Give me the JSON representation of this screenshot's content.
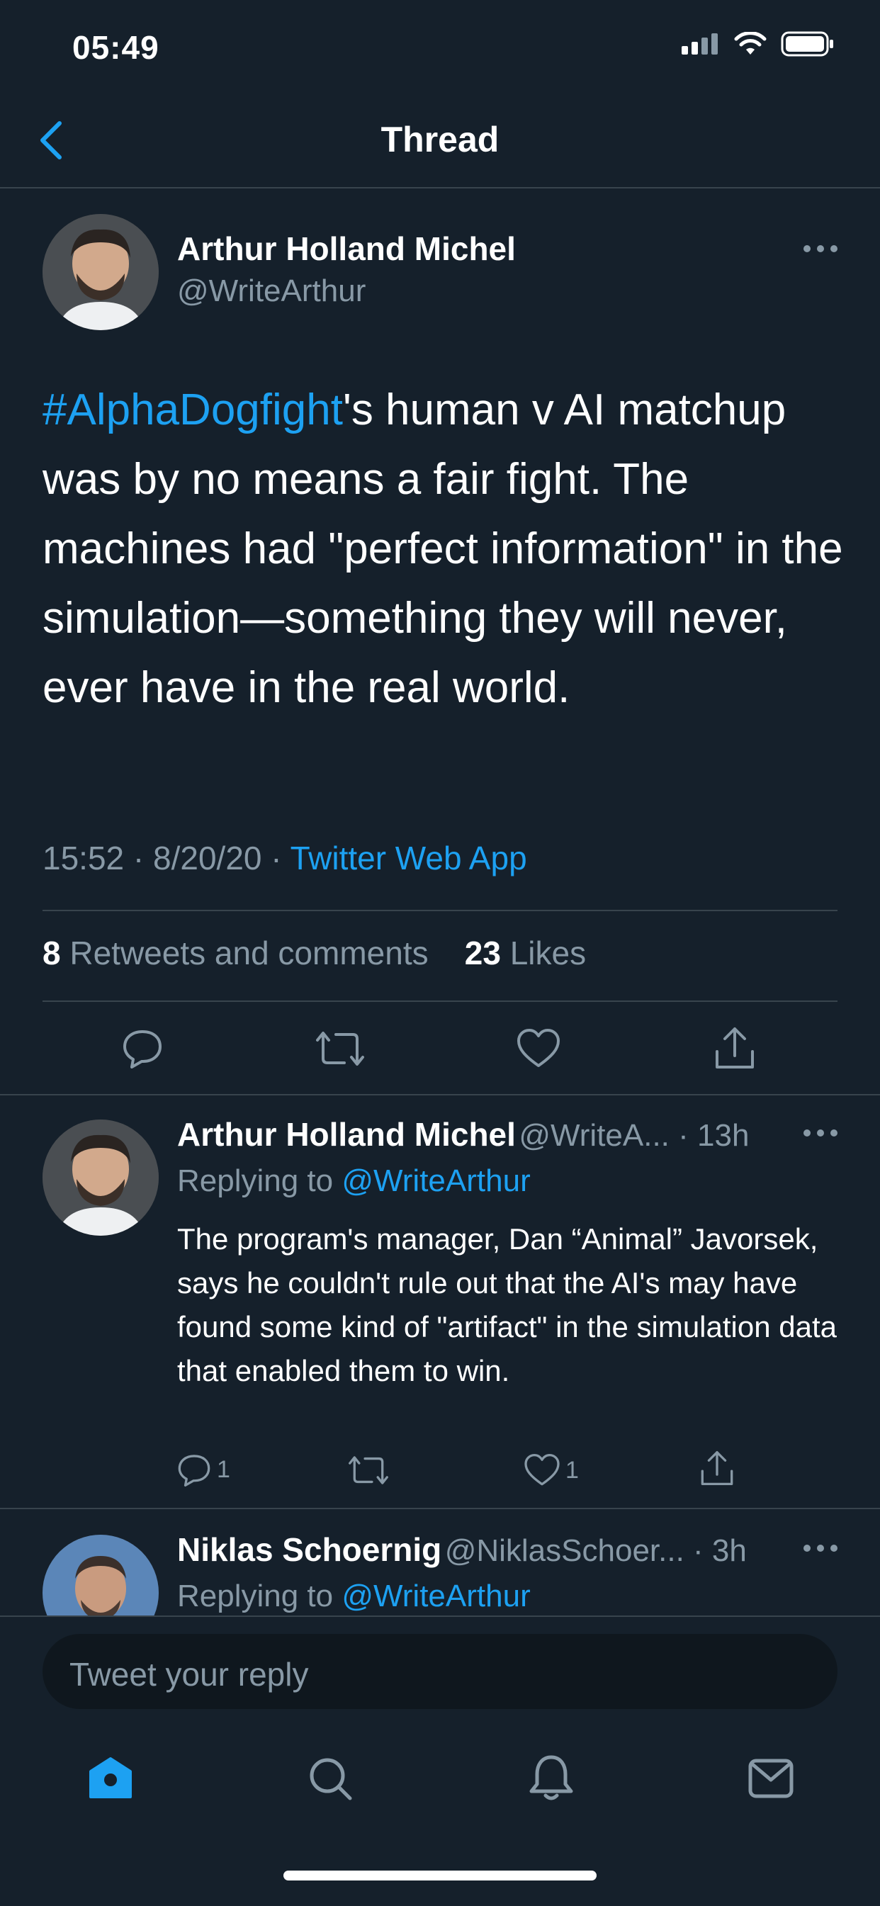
{
  "status": {
    "time": "05:49"
  },
  "nav": {
    "title": "Thread"
  },
  "main_tweet": {
    "author_name": "Arthur Holland Michel",
    "author_handle": "@WriteArthur",
    "hashtag": "#AlphaDogfight",
    "text_after_hashtag": "'s human v AI matchup was by no means a fair fight. The machines had \"perfect information\" in the simulation—something they will never, ever have in the real world.",
    "time": "15:52",
    "date": "8/20/20",
    "source": "Twitter Web App",
    "retweets_count": "8",
    "retweets_label": "Retweets and comments",
    "likes_count": "23",
    "likes_label": "Likes"
  },
  "replies": [
    {
      "name": "Arthur Holland Michel",
      "handle": "@WriteA...",
      "age": "13h",
      "replying_label": "Replying to",
      "replying_to": "@WriteArthur",
      "text": "The program's manager, Dan “Animal” Javorsek, says he couldn't rule out that the AI's may have found some kind of \"artifact\" in the simulation data that enabled them to win.",
      "reply_count": "1",
      "like_count": "1"
    },
    {
      "name": "Niklas Schoernig",
      "handle": "@NiklasSchoer...",
      "age": "3h",
      "replying_label": "Replying to",
      "replying_to": "@WriteArthur"
    }
  ],
  "composer": {
    "placeholder": "Tweet your reply"
  },
  "tabbar": {
    "items": [
      "home-icon",
      "search-icon",
      "notifications-icon",
      "messages-icon"
    ],
    "active_color": "#1da1f2"
  },
  "colors": {
    "background": "#15202b",
    "accent": "#1da1f2",
    "muted": "#8899a6",
    "divider": "#38444d"
  }
}
